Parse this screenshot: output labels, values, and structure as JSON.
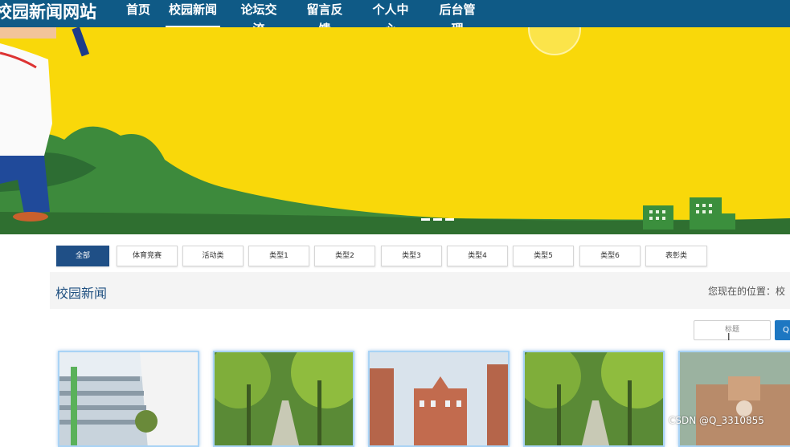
{
  "site": {
    "brand": "校园新闻网站"
  },
  "nav": {
    "items": [
      {
        "label": "首页"
      },
      {
        "label": "校园新闻"
      },
      {
        "label": "论坛交流"
      },
      {
        "label": "留言反馈"
      },
      {
        "label": "个人中心"
      },
      {
        "label": "后台管理"
      }
    ],
    "active_index": 1
  },
  "filters": {
    "items": [
      {
        "label": "全部"
      },
      {
        "label": "体育竞赛"
      },
      {
        "label": "活动类"
      },
      {
        "label": "类型1"
      },
      {
        "label": "类型2"
      },
      {
        "label": "类型3"
      },
      {
        "label": "类型4"
      },
      {
        "label": "类型5"
      },
      {
        "label": "类型6"
      },
      {
        "label": "表彰类"
      }
    ],
    "active_index": 0
  },
  "section": {
    "title": "校园新闻",
    "breadcrumb": "您现在的位置：校"
  },
  "search": {
    "placeholder": "标题",
    "button_label": "Q"
  },
  "watermark": "CSDN @Q_3310855"
}
